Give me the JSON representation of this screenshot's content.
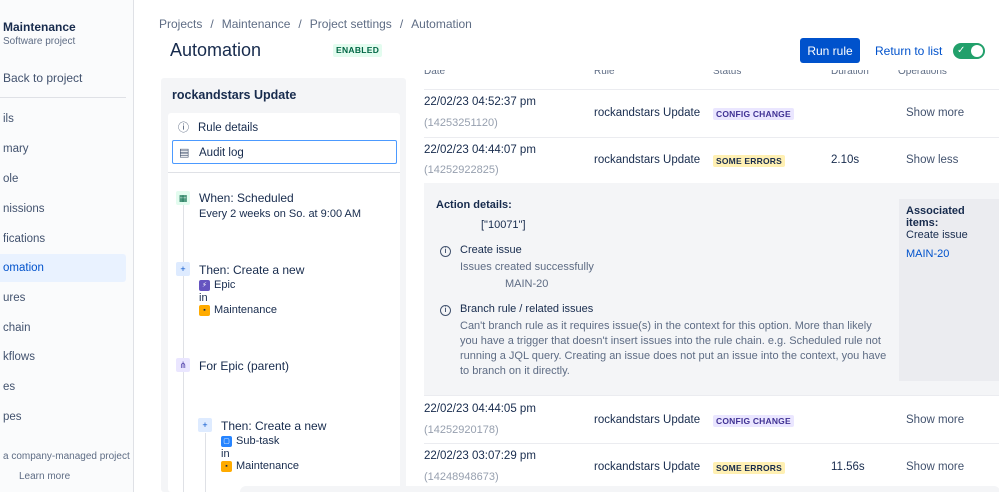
{
  "sidebar": {
    "project_name": "Maintenance",
    "project_type": "Software project",
    "back_label": "Back to project",
    "items": [
      {
        "label": "ils"
      },
      {
        "label": "mary"
      },
      {
        "label": "ole"
      },
      {
        "label": "nissions"
      },
      {
        "label": "fications"
      },
      {
        "label": "omation"
      },
      {
        "label": "ures"
      },
      {
        "label": "chain"
      },
      {
        "label": "kflows"
      },
      {
        "label": "es"
      },
      {
        "label": "pes"
      }
    ],
    "active_index": 5,
    "footer_text": "a company-managed project",
    "learn_more": "Learn more"
  },
  "header": {
    "breadcrumb": [
      "Projects",
      "Maintenance",
      "Project settings",
      "Automation"
    ],
    "title": "Automation",
    "status_badge": "ENABLED",
    "run_button": "Run rule",
    "return_link": "Return to list",
    "toggle_on": true
  },
  "rule": {
    "name": "rockandstars Update",
    "menu": [
      {
        "label": "Rule details",
        "icon": "info-icon"
      },
      {
        "label": "Audit log",
        "icon": "document-icon"
      }
    ],
    "components": {
      "trigger": {
        "title": "When: Scheduled",
        "subtitle": "Every 2 weeks on So. at 9:00 AM"
      },
      "action1": {
        "title": "Then: Create a new",
        "issue_type": "Epic",
        "in_label": "in",
        "project": "Maintenance"
      },
      "branch": {
        "title": "For Epic (parent)"
      },
      "action2": {
        "title": "Then: Create a new",
        "issue_type": "Sub-task",
        "in_label": "in",
        "project": "Maintenance"
      }
    }
  },
  "table": {
    "columns": [
      "Date",
      "Rule",
      "Status",
      "Duration",
      "Operations"
    ],
    "rows": [
      {
        "date": "22/02/23 04:52:37 pm",
        "id": "(14253251120)",
        "rule": "rockandstars Update",
        "status": "CONFIG CHANGE",
        "duration": "",
        "operation": "Show more"
      },
      {
        "date": "22/02/23 04:44:07 pm",
        "id": "(14252922825)",
        "rule": "rockandstars Update",
        "status": "SOME ERRORS",
        "duration": "2.10s",
        "operation": "Show less"
      },
      {
        "date": "22/02/23 04:44:05 pm",
        "id": "(14252920178)",
        "rule": "rockandstars Update",
        "status": "CONFIG CHANGE",
        "duration": "",
        "operation": "Show more"
      },
      {
        "date": "22/02/23 03:07:29 pm",
        "id": "(14248948673)",
        "rule": "rockandstars Update",
        "status": "SOME ERRORS",
        "duration": "11.56s",
        "operation": "Show more"
      }
    ]
  },
  "details": {
    "title": "Action details:",
    "json": "[\"10071\"]",
    "create_issue": {
      "heading": "Create issue",
      "text": "Issues created successfully",
      "key": "MAIN-20"
    },
    "branch": {
      "heading": "Branch rule / related issues",
      "lines": [
        "Can't branch rule as it requires issue(s) in the context for this option. More than likely",
        "you have a trigger that doesn't insert issues into the rule chain. e.g. Scheduled rule not",
        "running a JQL query. Creating an issue does not put an issue into the context, you have",
        "to branch on it directly."
      ]
    },
    "associated": {
      "title": "Associated items:",
      "subtitle": "Create issue",
      "link": "MAIN-20"
    }
  },
  "colors": {
    "primary": "#0052cc",
    "enabled_bg": "#e3fcef",
    "config_change_bg": "#eae6ff",
    "some_errors_bg": "#fff0b3",
    "toggle_on": "#22a06b"
  }
}
